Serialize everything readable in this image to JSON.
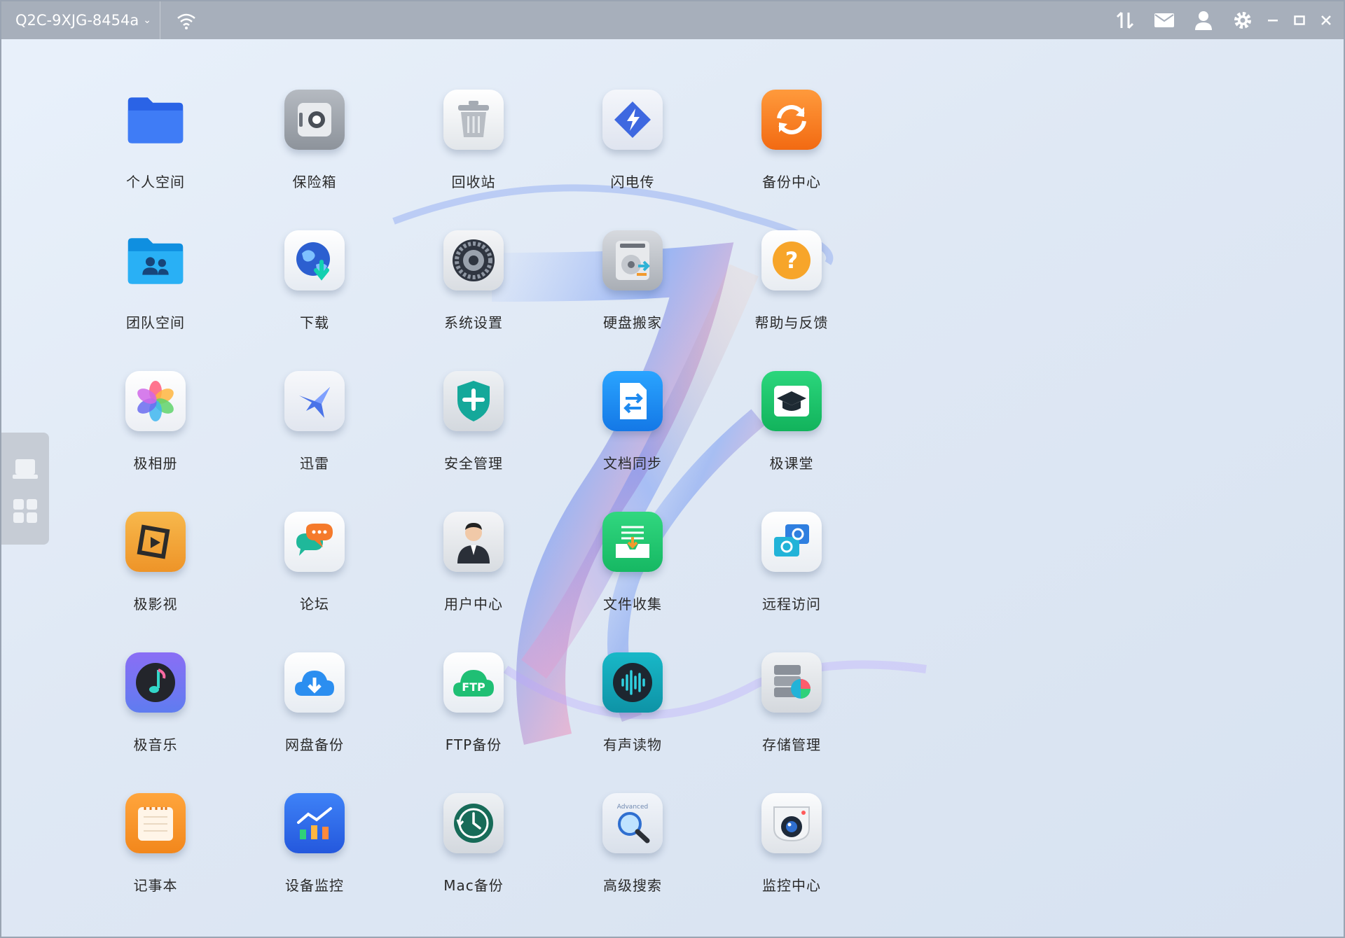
{
  "titlebar": {
    "device_name": "Q2C-9XJG-8454a",
    "icons": [
      "wifi-icon",
      "transfer-icon",
      "mail-icon",
      "user-icon",
      "settings-icon",
      "minimize-icon",
      "maximize-icon",
      "close-icon"
    ]
  },
  "side_dock": {
    "items": [
      "device-icon",
      "apps-grid-icon"
    ]
  },
  "apps": [
    {
      "id": "personal-space",
      "label": "个人空间",
      "icon": "folder-icon",
      "color": "#2f6ef2"
    },
    {
      "id": "safe",
      "label": "保险箱",
      "icon": "safe-icon",
      "color": "#9aa0a8"
    },
    {
      "id": "recycle-bin",
      "label": "回收站",
      "icon": "trash-icon",
      "color": "#e9ecef"
    },
    {
      "id": "flash-transfer",
      "label": "闪电传",
      "icon": "lightning-icon",
      "color": "#3f6de0"
    },
    {
      "id": "backup-center",
      "label": "备份中心",
      "icon": "sync-icon",
      "color": "#f77d1e"
    },
    {
      "id": "team-space",
      "label": "团队空间",
      "icon": "team-folder-icon",
      "color": "#1ea8ee"
    },
    {
      "id": "download",
      "label": "下载",
      "icon": "globe-download-icon",
      "color": "#2656c8"
    },
    {
      "id": "system-settings",
      "label": "系统设置",
      "icon": "gear-icon",
      "color": "#5c6470"
    },
    {
      "id": "disk-migration",
      "label": "硬盘搬家",
      "icon": "disk-icon",
      "color": "#b0b4ba"
    },
    {
      "id": "help-feedback",
      "label": "帮助与反馈",
      "icon": "help-icon",
      "color": "#f5a324"
    },
    {
      "id": "photo-album",
      "label": "极相册",
      "icon": "photos-icon",
      "color": "#ffffff"
    },
    {
      "id": "thunder",
      "label": "迅雷",
      "icon": "bird-icon",
      "color": "#4b74e6"
    },
    {
      "id": "security",
      "label": "安全管理",
      "icon": "shield-icon",
      "color": "#17a79a"
    },
    {
      "id": "doc-sync",
      "label": "文档同步",
      "icon": "doc-sync-icon",
      "color": "#1a8ff0"
    },
    {
      "id": "classroom",
      "label": "极课堂",
      "icon": "graduation-cap-icon",
      "color": "#19c26a"
    },
    {
      "id": "video",
      "label": "极影视",
      "icon": "film-icon",
      "color": "#f3a33a"
    },
    {
      "id": "forum",
      "label": "论坛",
      "icon": "chat-icon",
      "color": "#f57a2b"
    },
    {
      "id": "user-center",
      "label": "用户中心",
      "icon": "person-icon",
      "color": "#333a44"
    },
    {
      "id": "file-collect",
      "label": "文件收集",
      "icon": "inbox-icon",
      "color": "#22c46b"
    },
    {
      "id": "remote-access",
      "label": "远程访问",
      "icon": "remote-link-icon",
      "color": "#2a86d8"
    },
    {
      "id": "music",
      "label": "极音乐",
      "icon": "music-note-icon",
      "color": "#7d62e8"
    },
    {
      "id": "cloud-backup",
      "label": "网盘备份",
      "icon": "cloud-download-icon",
      "color": "#2b8ef0"
    },
    {
      "id": "ftp-backup",
      "label": "FTP备份",
      "icon": "ftp-icon",
      "color": "#1fbf74"
    },
    {
      "id": "audiobook",
      "label": "有声读物",
      "icon": "audio-wave-icon",
      "color": "#12a6b8"
    },
    {
      "id": "storage-manager",
      "label": "存储管理",
      "icon": "storage-chart-icon",
      "color": "#8c949e"
    },
    {
      "id": "notepad",
      "label": "记事本",
      "icon": "notepad-icon",
      "color": "#f79a2a"
    },
    {
      "id": "device-monitor",
      "label": "设备监控",
      "icon": "bar-chart-icon",
      "color": "#2f6ef2"
    },
    {
      "id": "mac-backup",
      "label": "Mac备份",
      "icon": "clock-icon",
      "color": "#176b58"
    },
    {
      "id": "advanced-search",
      "label": "高级搜索",
      "icon": "magnifier-icon",
      "color": "#dfe6f0",
      "badge": "Advanced"
    },
    {
      "id": "surveillance",
      "label": "监控中心",
      "icon": "camera-icon",
      "color": "#eef1f4"
    }
  ]
}
